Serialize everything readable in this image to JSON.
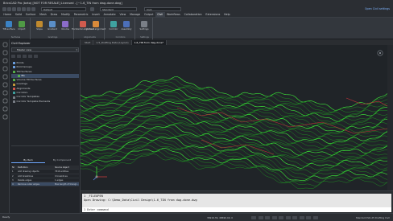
{
  "window": {
    "title": "BricsCAD Pro (beta) [NOT FOR RESALE] Licensed - [~1-6_TIN from dwg-done.dwg]",
    "controls": [
      "minimize-icon",
      "maximize-icon",
      "close-icon"
    ]
  },
  "quick_access": {
    "layer_field": "Default",
    "workspace_field": "Civil",
    "standard_field": "Standard",
    "right_link": "Open Civil settings"
  },
  "menu": {
    "items": [
      "Home",
      "Solid",
      "Surface",
      "Mesh",
      "Draw",
      "Modify",
      "Parametric",
      "Insert",
      "Annotate",
      "View",
      "Manage",
      "Output",
      "Civil",
      "Workflows",
      "Collaboration",
      "Extensions",
      "Help"
    ],
    "active": "Civil"
  },
  "ribbon": {
    "groups": [
      {
        "label": "Surfaces",
        "buttons": [
          {
            "label": "TIN surface",
            "color": "#3b82c4"
          },
          {
            "label": "Import",
            "color": "#4f9a45"
          }
        ]
      },
      {
        "label": "Gradings",
        "buttons": [
          {
            "label": "Slope",
            "color": "#c08a2e"
          },
          {
            "label": "Gradient",
            "color": "#5a8ec7"
          },
          {
            "label": "Volume",
            "color": "#8b6cc9"
          }
        ]
      },
      {
        "label": "Alignments",
        "buttons": [
          {
            "label": "Horizontal alignment",
            "color": "#d05b4e"
          },
          {
            "label": "Vertical alignment",
            "color": "#d98a3a"
          }
        ]
      },
      {
        "label": "Corridors",
        "buttons": [
          {
            "label": "Corridor",
            "color": "#3fa2a0"
          },
          {
            "label": "Assembly",
            "color": "#4c6fb8"
          }
        ]
      },
      {
        "label": "Settings",
        "buttons": [
          {
            "label": "Settings",
            "color": "#7a7f87"
          }
        ]
      }
    ]
  },
  "left_tools": [
    "layers-icon",
    "properties-icon",
    "civil-explorer-icon",
    "structure-icon",
    "library-icon",
    "blocks-icon",
    "materials-icon",
    "lights-icon",
    "attach-icon",
    "help-icon"
  ],
  "panel": {
    "title": "Civil Explorer",
    "dropdown": "Master view",
    "tree": [
      {
        "label": "Points",
        "color": "#6b9fe0"
      },
      {
        "label": "Point Groups",
        "color": "#6b9fe0"
      },
      {
        "label": "TIN Surfaces",
        "color": "#54b04a"
      },
      {
        "label": "EG",
        "color": "#54b04a",
        "selected": true
      },
      {
        "label": "Volume TIN Surfaces",
        "color": "#54b04a"
      },
      {
        "label": "Gradings",
        "color": "#c69a3a"
      },
      {
        "label": "Alignments",
        "color": "#d0574b"
      },
      {
        "label": "Corridors",
        "color": "#3fa2a0"
      },
      {
        "label": "Corridor Templates",
        "color": "#7a7f87"
      },
      {
        "label": "Corridor Template Elements",
        "color": "#7a7f87"
      }
    ],
    "tabs": [
      {
        "label": "By Item",
        "active": true
      },
      {
        "label": "By Component",
        "active": false
      }
    ],
    "table": {
      "headers": [
        "Nr",
        "Definition",
        "Source object"
      ],
      "rows": [
        {
          "nr": "1",
          "definition": "Add drawing objects",
          "source": "7616 entities"
        },
        {
          "nr": "2",
          "definition": "Add breaklines",
          "source": "0 breaklines"
        },
        {
          "nr": "3",
          "definition": "Delete edges",
          "source": "1 edges"
        },
        {
          "nr": "4",
          "definition": "Remove outer edges",
          "source": "Max length of triangl..."
        }
      ]
    }
  },
  "doc_tabs": {
    "items": [
      "Start",
      "1-5_Drafting Data (Layout)",
      "1-6_TIN from dwg-done*"
    ],
    "active": "1-6_TIN from dwg-done*"
  },
  "command": {
    "history": [
      "1 _FILEOPEN",
      "Open Drawing: C:\\Demo_Data\\Civil Design\\1-6_TIN from dwg-done.dwg"
    ],
    "prompt": "1 Enter command"
  },
  "status": {
    "left": "Ready",
    "coords": "36916.36, 48690.40, 0",
    "right": "Standard ISO-25 Drafting Civil"
  },
  "colors": {
    "contour_green": "#3ef03a",
    "contour_dark": "#1fa322",
    "line_red": "#c8343a",
    "accent": "#6fa8ff"
  }
}
